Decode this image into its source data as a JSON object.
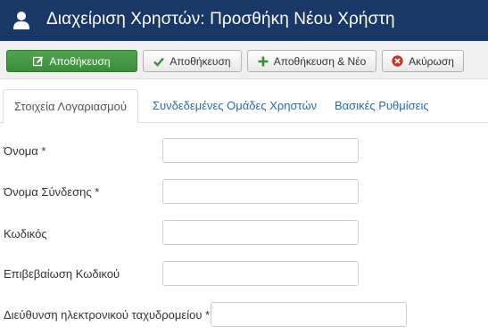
{
  "header": {
    "title": "Διαχείριση Χρηστών: Προσθήκη Νέου Χρήστη",
    "icon": "user-icon"
  },
  "toolbar": {
    "save_close_label": "Αποθήκευση",
    "save_label": "Αποθήκευση",
    "save_new_label": "Αποθήκευση & Νέο",
    "cancel_label": "Ακύρωση",
    "primary_color": "#46a046",
    "cancel_icon_color": "#c0392b"
  },
  "tabs": [
    {
      "label": "Στοιχεία Λογαριασμού",
      "active": true
    },
    {
      "label": "Συνδεδεμένες Ομάδες Χρηστών",
      "active": false
    },
    {
      "label": "Βασικές Ρυθμίσεις",
      "active": false
    }
  ],
  "form": {
    "fields": [
      {
        "label": "Όνομα *",
        "value": ""
      },
      {
        "label": "Όνομα Σύνδεσης *",
        "value": ""
      },
      {
        "label": "Κωδικός",
        "value": ""
      },
      {
        "label": "Επιβεβαίωση Κωδικού",
        "value": ""
      },
      {
        "label": "Διεύθυνση ηλεκτρονικού ταχυδρομείου *",
        "value": ""
      }
    ]
  }
}
